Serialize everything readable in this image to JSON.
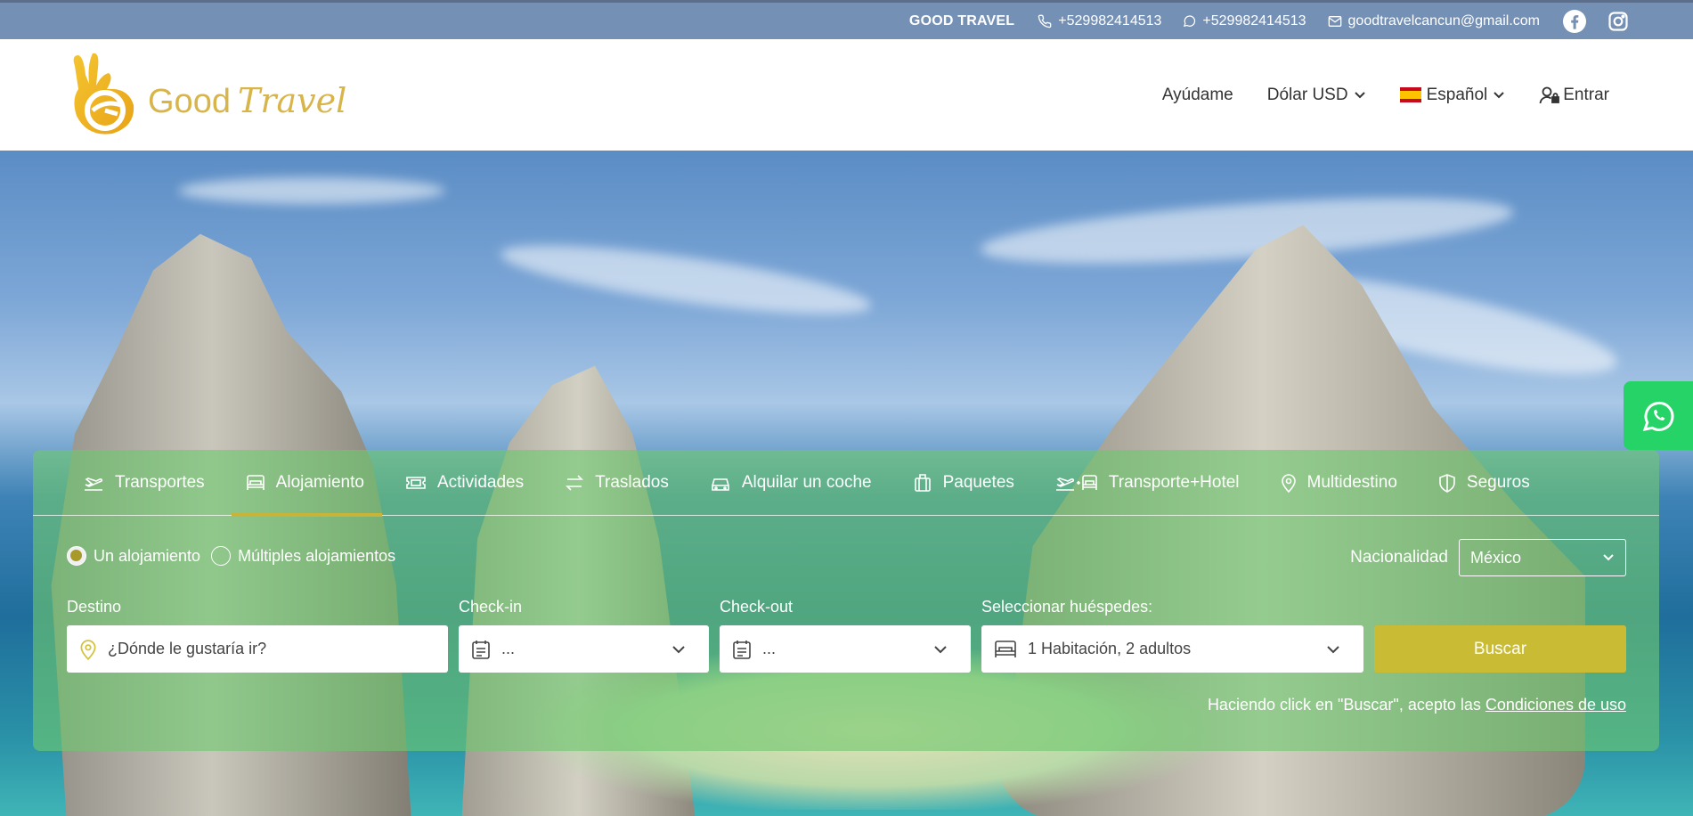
{
  "topbar": {
    "brand": "GOOD TRAVEL",
    "phone": "+529982414513",
    "whatsapp": "+529982414513",
    "email": "goodtravelcancun@gmail.com",
    "icons": [
      "phone-icon",
      "whatsapp-icon",
      "mail-icon",
      "facebook-icon",
      "instagram-icon"
    ]
  },
  "header": {
    "logo_word1": "Good",
    "logo_word2": "Travel",
    "nav": {
      "help": "Ayúdame",
      "currency": "Dólar USD",
      "language": "Español",
      "login": "Entrar"
    }
  },
  "search": {
    "tabs": [
      {
        "label": "Transportes",
        "icon": "plane-icon"
      },
      {
        "label": "Alojamiento",
        "icon": "bed-icon",
        "active": true
      },
      {
        "label": "Actividades",
        "icon": "ticket-icon"
      },
      {
        "label": "Traslados",
        "icon": "swap-icon"
      },
      {
        "label": "Alquilar un coche",
        "icon": "car-icon"
      },
      {
        "label": "Paquetes",
        "icon": "suitcase-icon"
      },
      {
        "label": "Transporte+Hotel",
        "icon": "plane-bed-icon"
      },
      {
        "label": "Multidestino",
        "icon": "pin-icon"
      },
      {
        "label": "Seguros",
        "icon": "shield-icon"
      }
    ],
    "mode_single": "Un alojamiento",
    "mode_multi": "Múltiples alojamientos",
    "nationality_label": "Nacionalidad",
    "nationality_value": "México",
    "destination_label": "Destino",
    "destination_placeholder": "¿Dónde le gustaría ir?",
    "checkin_label": "Check-in",
    "checkin_value": "...",
    "checkout_label": "Check-out",
    "checkout_value": "...",
    "guests_label": "Seleccionar huéspedes:",
    "guests_value": "1 Habitación, 2 adultos",
    "search_button": "Buscar",
    "terms_text": "Haciendo click en \"Buscar\", acepto las",
    "terms_link": "Condiciones de uso"
  },
  "colors": {
    "topbar": "#7590b5",
    "accent": "#c9bc34",
    "panel": "#6ec86e",
    "logo": "#d8b54a",
    "whatsapp": "#25d366"
  }
}
